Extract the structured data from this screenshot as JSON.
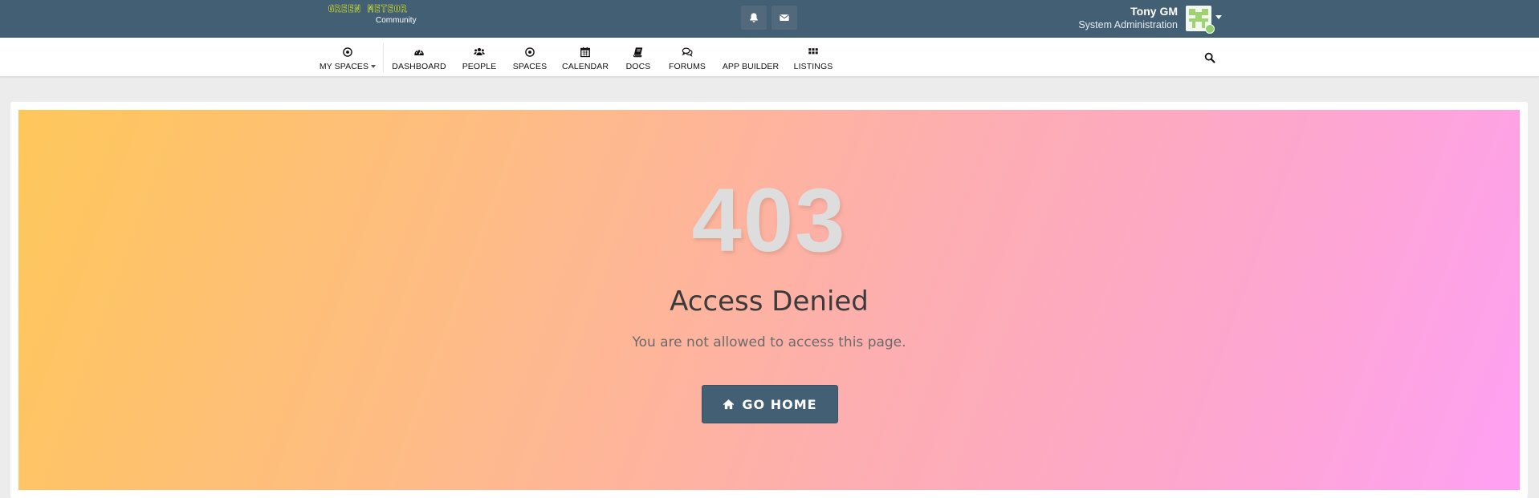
{
  "header": {
    "logo_text": "GREEN METEOR",
    "logo_sub": "Community",
    "notifications_icon": "bell-icon",
    "messages_icon": "envelope-icon",
    "user_name": "Tony GM",
    "user_role": "System Administration",
    "status_color": "#8ed16e",
    "bar_color": "#435f73"
  },
  "nav": {
    "items": [
      {
        "label": "MY SPACES",
        "icon": "target-icon"
      },
      {
        "label": "DASHBOARD",
        "icon": "dashboard-icon"
      },
      {
        "label": "PEOPLE",
        "icon": "people-icon"
      },
      {
        "label": "SPACES",
        "icon": "target-icon"
      },
      {
        "label": "CALENDAR",
        "icon": "calendar-icon"
      },
      {
        "label": "DOCS",
        "icon": "book-icon"
      },
      {
        "label": "FORUMS",
        "icon": "comments-icon"
      },
      {
        "label": "APP BUILDER",
        "icon": "puzzle-icon"
      },
      {
        "label": "LISTINGS",
        "icon": "grid-icon"
      }
    ],
    "search_icon": "search-icon"
  },
  "error": {
    "code": "403",
    "title": "Access Denied",
    "message": "You are not allowed to access this page.",
    "button_label": "GO HOME",
    "button_icon": "home-icon",
    "gradient_start": "#fec75a",
    "gradient_end": "#ffa0f4"
  }
}
